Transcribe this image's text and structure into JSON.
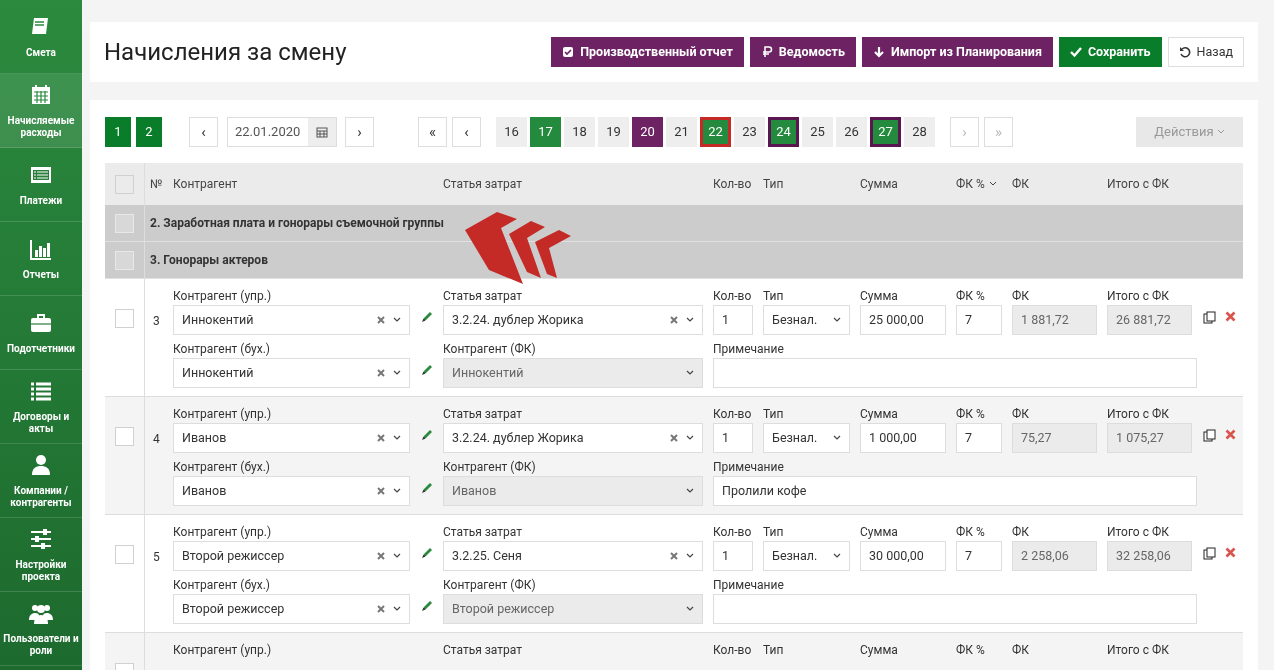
{
  "sidebar": {
    "items": [
      {
        "label": "Смета",
        "selected": false
      },
      {
        "label": "Начисляемые расходы",
        "selected": true
      },
      {
        "label": "Платежи",
        "selected": false
      },
      {
        "label": "Отчеты",
        "selected": false
      },
      {
        "label": "Подотчетники",
        "selected": false
      },
      {
        "label": "Договоры и акты",
        "selected": false
      },
      {
        "label": "Компании / контрагенты",
        "selected": false
      },
      {
        "label": "Настройки проекта",
        "selected": false
      },
      {
        "label": "Пользователи и роли",
        "selected": false
      }
    ]
  },
  "header": {
    "title": "Начисления за смену",
    "buttons": [
      {
        "label": "Производственный отчет",
        "kind": "purple"
      },
      {
        "label": "Ведомость",
        "kind": "purple"
      },
      {
        "label": "Импорт из Планирования",
        "kind": "purple"
      },
      {
        "label": "Сохранить",
        "kind": "green"
      },
      {
        "label": "Назад",
        "kind": "plain"
      }
    ]
  },
  "toolbar": {
    "pages": [
      {
        "label": "1"
      },
      {
        "label": "2"
      }
    ],
    "date_prev": "‹",
    "date": "22.01.2020",
    "date_next": "›",
    "first": "«",
    "prev": "‹",
    "days": [
      {
        "label": "16",
        "kind": "plain",
        "current": false,
        "marked": false
      },
      {
        "label": "17",
        "kind": "green",
        "current": false,
        "marked": false
      },
      {
        "label": "18",
        "kind": "plain",
        "current": false,
        "marked": false
      },
      {
        "label": "19",
        "kind": "plain",
        "current": false,
        "marked": false
      },
      {
        "label": "20",
        "kind": "purple",
        "current": false,
        "marked": false
      },
      {
        "label": "21",
        "kind": "plain",
        "current": false,
        "marked": false
      },
      {
        "label": "22",
        "kind": "green",
        "current": true,
        "marked": false
      },
      {
        "label": "23",
        "kind": "plain",
        "current": false,
        "marked": false
      },
      {
        "label": "24",
        "kind": "green",
        "current": false,
        "marked": true
      },
      {
        "label": "25",
        "kind": "plain",
        "current": false,
        "marked": false
      },
      {
        "label": "26",
        "kind": "plain",
        "current": false,
        "marked": false
      },
      {
        "label": "27",
        "kind": "green",
        "current": false,
        "marked": true
      },
      {
        "label": "28",
        "kind": "plain",
        "current": false,
        "marked": false
      }
    ],
    "next": "›",
    "last": "»",
    "actions": "Действия",
    "actions_disabled": true
  },
  "table": {
    "columns": [
      "№",
      "Контрагент",
      "Статья затрат",
      "Кол-во",
      "Тип",
      "Сумма",
      "ФК %",
      "ФК",
      "Итого с ФК"
    ],
    "header_checked": false,
    "groups": [
      {
        "label": "2. Заработная плата и гонорары съемочной группы",
        "checked": false
      },
      {
        "label": "3. Гонорары актеров",
        "checked": false
      }
    ],
    "rows": [
      {
        "number": "3",
        "checked": false,
        "labels": [
          "Контрагент (упр.)",
          "Статья затрат",
          "Кол-во",
          "Тип",
          "Сумма",
          "ФК %",
          "ФК",
          "Итого с ФК",
          "Контрагент (бух.)",
          "Контрагент (ФК)",
          "Примечание"
        ],
        "contractor_mgr": "Иннокентий",
        "article": "3.2.24. дублер Жорика",
        "qty": "1",
        "type": "Безнал.",
        "sum": "25 000,00",
        "fk_pct": "7",
        "fk": "1 881,72",
        "total": "26 881,72",
        "contractor_acc": "Иннокентий",
        "contractor_fk": "Иннокентий"
      },
      {
        "number": "4",
        "checked": false,
        "labels": [
          "Контрагент (упр.)",
          "Статья затрат",
          "Кол-во",
          "Тип",
          "Сумма",
          "ФК %",
          "ФК",
          "Итого с ФК",
          "Контрагент (бух.)",
          "Контрагент (ФК)",
          "Примечание"
        ],
        "contractor_mgr": "Иванов",
        "article": "3.2.24. дублер Жорика",
        "qty": "1",
        "type": "Безнал.",
        "sum": "1 000,00",
        "fk_pct": "7",
        "fk": "75,27",
        "total": "1 075,27",
        "contractor_acc": "Иванов",
        "contractor_fk": "Иванов",
        "note": "Пролили кофе"
      },
      {
        "number": "5",
        "checked": false,
        "labels": [
          "Контрагент (упр.)",
          "Статья затрат",
          "Кол-во",
          "Тип",
          "Сумма",
          "ФК %",
          "ФК",
          "Итого с ФК",
          "Контрагент (бух.)",
          "Контрагент (ФК)",
          "Примечание"
        ],
        "contractor_mgr": "Второй режиссер",
        "article": "3.2.25. Сеня",
        "qty": "1",
        "type": "Безнал.",
        "sum": "30 000,00",
        "fk_pct": "7",
        "fk": "2 258,06",
        "total": "32 258,06",
        "contractor_acc": "Второй режиссер",
        "contractor_fk": "Второй режиссер"
      },
      {
        "labels": [
          "Контрагент (упр.)",
          "Статья затрат",
          "Кол-во",
          "Тип",
          "Сумма",
          "ФК %",
          "ФК",
          "Итого с ФК"
        ],
        "checked": false
      }
    ]
  }
}
